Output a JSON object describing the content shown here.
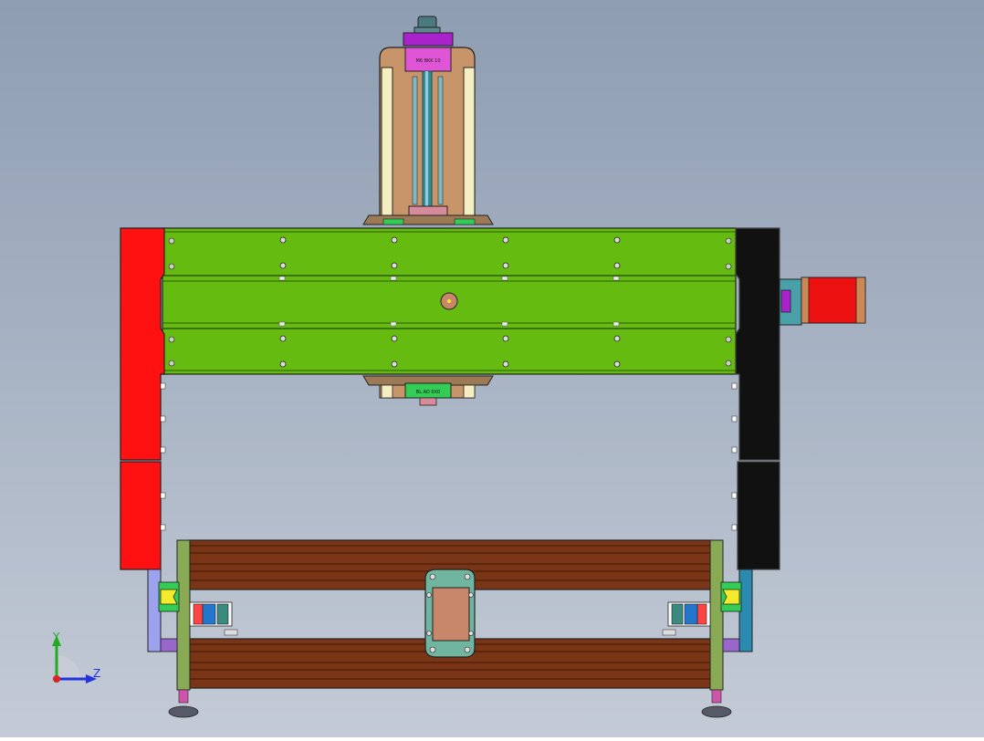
{
  "viewport": {
    "background_top": "#8e9db2",
    "background_bottom": "#c4cbd6"
  },
  "model": {
    "z_axis_label_top": "M6 BKK 10",
    "z_axis_label_bottom": "BL AO 0X0",
    "colors": {
      "gantry_beam": "#66bb11",
      "left_side_plate": "#ff1111",
      "right_side_plate": "#111111",
      "z_plate": "#c8956a",
      "z_rail": "#f4eec0",
      "base_rail": "#7a3516",
      "end_plate": "#88aa55",
      "motor_body": "#ee1111",
      "carriage_outer": "#6fb5a0",
      "carriage_inner": "#c8866a",
      "rail_block": "#f2ea2a",
      "coupler_purple": "#aa22cc"
    },
    "icons": [
      "stepper-motor-icon",
      "lead-screw-icon",
      "bearing-block-icon",
      "leveling-foot-icon",
      "coordinate-triad-icon"
    ]
  },
  "triad": {
    "y_label": "Y",
    "z_label": "Z",
    "y_color": "#22aa22",
    "z_color": "#2233dd",
    "x_color": "#dd2222"
  }
}
